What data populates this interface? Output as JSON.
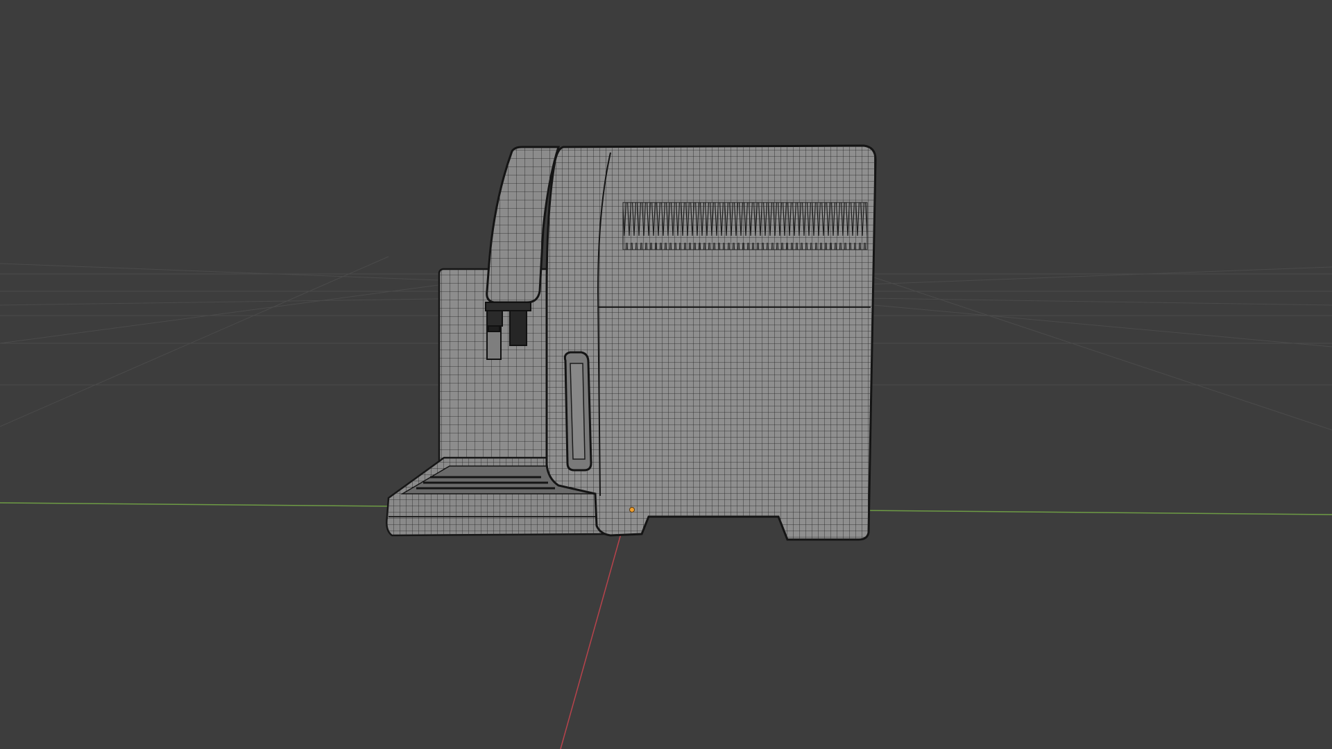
{
  "viewport": {
    "background": "#3d3d3d",
    "grid_color": "#4a4a4a",
    "x_axis_color": "#6e9c45",
    "y_axis_color": "#b8434c",
    "origin_color": "#f0a030"
  },
  "model": {
    "name": "coffee-machine-wireframe",
    "surface_color": "#8e8e8e",
    "wire_color": "#1c1c1c"
  }
}
